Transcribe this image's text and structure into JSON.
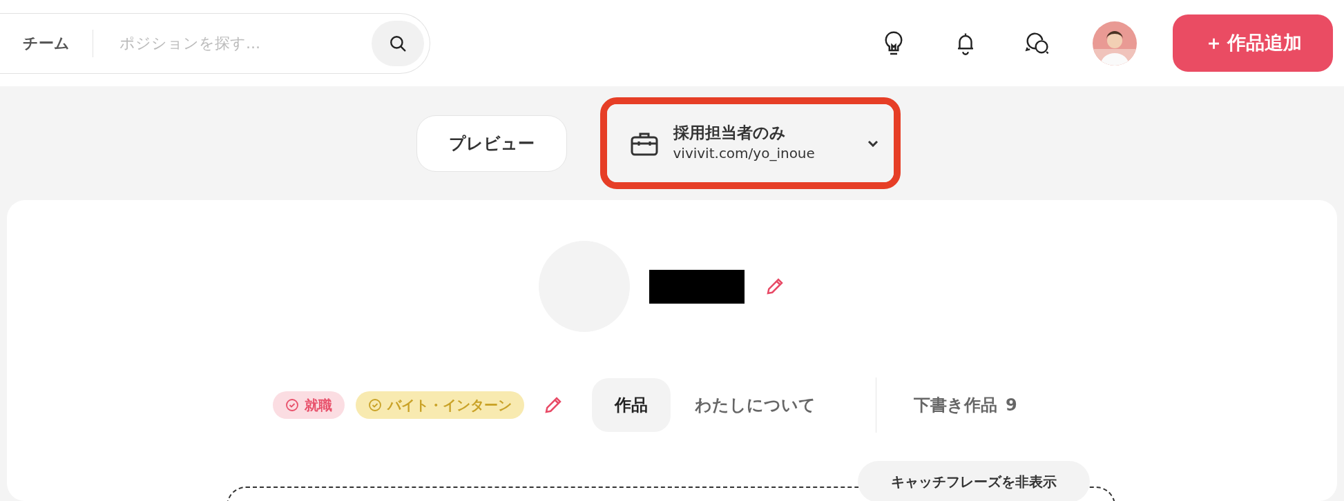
{
  "header": {
    "team_label": "チーム",
    "search": {
      "placeholder": "ポジションを探す..."
    },
    "add_button": "作品追加",
    "add_icon": "＋"
  },
  "visibility": {
    "preview_button": "プレビュー",
    "dropdown": {
      "title": "採用担当者のみ",
      "url": "vivivit.com/yo_inoue",
      "highlighted": true
    }
  },
  "profile": {
    "tags": [
      {
        "label": "就職",
        "color": "#e8506a"
      },
      {
        "label": "バイト・インターン",
        "color": "#c9a227"
      }
    ],
    "tabs": [
      {
        "label": "作品",
        "selected": true
      },
      {
        "label": "わたしについて",
        "selected": false
      }
    ],
    "drafts": {
      "label": "下書き作品",
      "count": "9"
    },
    "catchphrase_button": "キャッチフレーズを非表示"
  }
}
